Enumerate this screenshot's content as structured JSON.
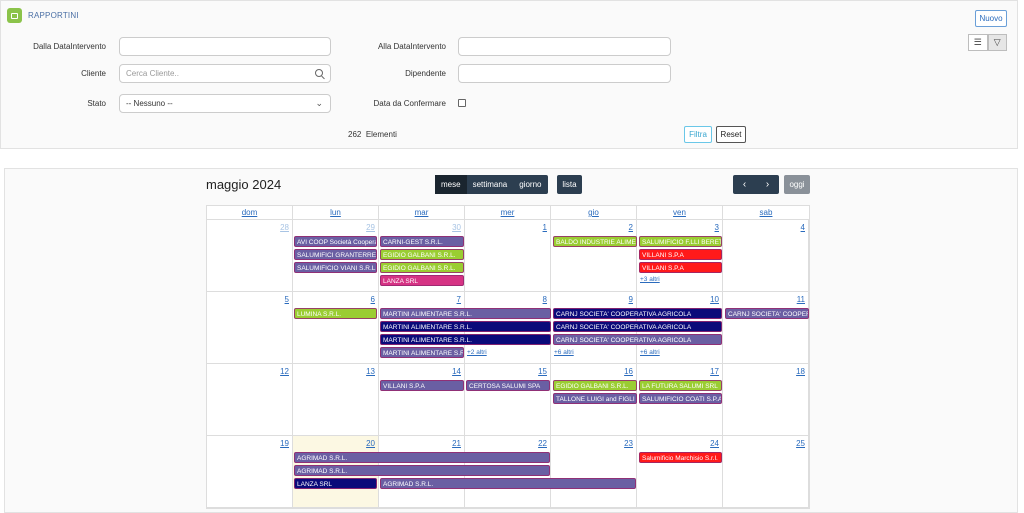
{
  "app": {
    "title": "RAPPORTINI",
    "new_label": "Nuovo"
  },
  "filters": {
    "dalla_label": "Dalla DataIntervento",
    "alla_label": "Alla DataIntervento",
    "cliente_label": "Cliente",
    "cliente_placeholder": "Cerca Cliente..",
    "dipendente_label": "Dipendente",
    "stato_label": "Stato",
    "stato_value": "-- Nessuno --",
    "confermare_label": "Data da Confermare",
    "count": "262",
    "count_label": "Elementi",
    "filtra_label": "Filtra",
    "reset_label": "Reset"
  },
  "calendar": {
    "title": "maggio 2024",
    "views": [
      "mese",
      "settimana",
      "giorno"
    ],
    "lista_label": "lista",
    "oggi_label": "oggi",
    "prev_icon": "‹",
    "next_icon": "›",
    "weekdays": [
      "dom",
      "lun",
      "mar",
      "mer",
      "gio",
      "ven",
      "sab"
    ],
    "weeks": [
      [
        "28",
        "29",
        "30",
        "1",
        "2",
        "3",
        "4"
      ],
      [
        "5",
        "6",
        "7",
        "8",
        "9",
        "10",
        "11"
      ],
      [
        "12",
        "13",
        "14",
        "15",
        "16",
        "17",
        "18"
      ],
      [
        "19",
        "20",
        "21",
        "22",
        "23",
        "24",
        "25"
      ]
    ],
    "events": {
      "w1": [
        "AVI COOP Società Cooperativa",
        "SALUMIFICI GRANTERRE",
        "SALUMIFICIO VIANI S.R.L.",
        "CARNI-GEST S.R.L.",
        "EGIDIO GALBANI S.R.L.",
        "EGIDIO GALBANI S.R.L.",
        "LANZA SRL",
        "BALDO INDUSTRIE ALIMENTARI",
        "SALUMIFICIO F.LLI BERETTA",
        "VILLANI S.P.A",
        "VILLANI S.P.A",
        "+3 altri"
      ],
      "w2": [
        "LUMINA S.R.L.",
        "MARTINI ALIMENTARE S.R.L.",
        "MARTINI ALIMENTARE S.R.L.",
        "MARTINI ALIMENTARE S.R.L.",
        "MARTINI ALIMENTARE S.R.L.",
        "+2 altri",
        "CARNJ SOCIETA' COOPERATIVA AGRICOLA",
        "CARNJ SOCIETA' COOPERATIVA AGRICOLA",
        "CARNJ SOCIETA' COOPERATIVA AGRICOLA",
        "+6 altri",
        "+6 altri",
        "CARNJ SOCIETA' COOPERATIVA AGRICOLA"
      ],
      "w3": [
        "VILLANI S.P.A",
        "CERTOSA SALUMI SPA",
        "EGIDIO GALBANI S.R.L.",
        "TALLONE LUIGI and FIGLI",
        "LA FUTURA SALUMI SRL",
        "SALUMIFICIO COATI S.P.A"
      ],
      "w4": [
        "AGRIMAD S.R.L.",
        "AGRIMAD S.R.L.",
        "LANZA SRL",
        "AGRIMAD S.R.L.",
        "Salumificio Marchisio S.r.l."
      ]
    },
    "colors": {
      "purple": "#6a5fa3",
      "green": "#9acd32",
      "red": "#ff1a1a",
      "navy": "#0a0a7a",
      "pink": "#d63384"
    }
  }
}
